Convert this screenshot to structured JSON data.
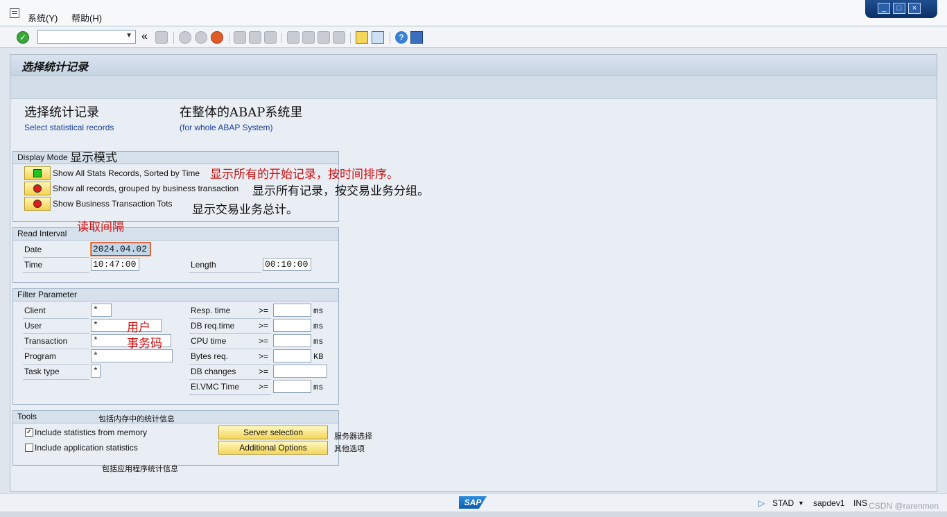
{
  "menu": {
    "system": "系统(Y)",
    "help": "帮助(H)"
  },
  "toolbar": {
    "command_value": "",
    "icons": [
      "enter-icon",
      "back-double-icon",
      "save-icon",
      "back-icon",
      "exit-icon",
      "cancel-icon",
      "print-icon",
      "find-icon",
      "find-next-icon",
      "first-page-icon",
      "prev-page-icon",
      "next-page-icon",
      "last-page-icon",
      "new-session-icon",
      "shortcut-icon",
      "help-icon",
      "layout-icon"
    ]
  },
  "screen": {
    "title": "选择统计记录",
    "heading_cn": "选择统计记录",
    "heading_en": "Select statistical records",
    "scope_cn": "在整体的ABAP系统里",
    "scope_en": "(for whole ABAP System)"
  },
  "display_mode": {
    "header": "Display Mode",
    "header_note": "显示模式",
    "options": [
      {
        "label": "Show All Stats Records, Sorted by Time",
        "note": "显示所有的开始记录，按时间排序。",
        "selected": true
      },
      {
        "label": "Show all records, grouped by business transaction",
        "note": "显示所有记录，按交易业务分组。",
        "selected": false
      },
      {
        "label": "Show Business Transaction Tots",
        "note": "显示交易业务总计。",
        "selected": false
      }
    ]
  },
  "read_interval": {
    "header": "Read Interval",
    "header_note": "读取间隔",
    "date_label": "Date",
    "date_value": "2024.04.02",
    "time_label": "Time",
    "time_value": "10:47:00",
    "length_label": "Length",
    "length_value": "00:10:00"
  },
  "filter": {
    "header": "Filter Parameter",
    "left": [
      {
        "label": "Client",
        "value": "*"
      },
      {
        "label": "User",
        "value": "*",
        "note": "用户"
      },
      {
        "label": "Transaction",
        "value": "*",
        "note": "事务码"
      },
      {
        "label": "Program",
        "value": "*"
      },
      {
        "label": "Task type",
        "value": "*"
      }
    ],
    "right": [
      {
        "label": "Resp. time",
        "op": ">=",
        "value": "",
        "unit": "ms"
      },
      {
        "label": "DB req.time",
        "op": ">=",
        "value": "",
        "unit": "ms"
      },
      {
        "label": "CPU time",
        "op": ">=",
        "value": "",
        "unit": "ms"
      },
      {
        "label": "Bytes req.",
        "op": ">=",
        "value": "",
        "unit": "KB"
      },
      {
        "label": "DB changes",
        "op": ">=",
        "value": "",
        "unit": ""
      },
      {
        "label": "El.VMC Time",
        "op": ">=",
        "value": "",
        "unit": "ms"
      }
    ]
  },
  "tools": {
    "header": "Tools",
    "memory_note": "包括内存中的统计信息",
    "include_memory": {
      "label": "Include statistics from memory",
      "checked": true
    },
    "include_app": {
      "label": "Include application statistics",
      "checked": false
    },
    "app_note": "包括应用程序统计信息",
    "server_button": "Server selection",
    "server_note": "服务器选择",
    "options_button": "Additional Options",
    "options_note": "其他选项"
  },
  "status": {
    "transaction": "STAD",
    "server": "sapdev1",
    "mode": "INS",
    "logo": "SAP"
  },
  "watermark": "CSDN @rarenmen"
}
